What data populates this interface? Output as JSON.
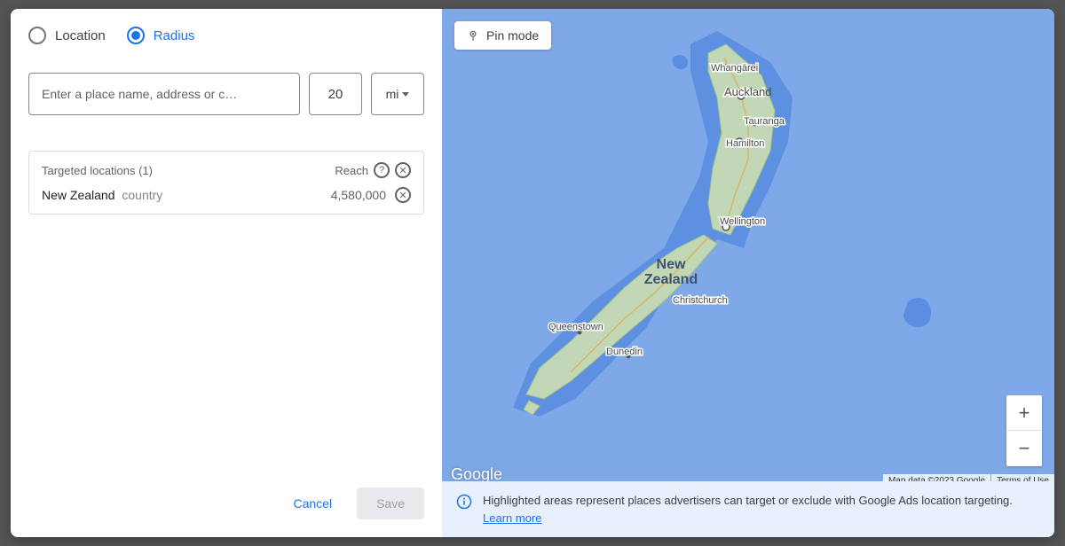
{
  "radio": {
    "location": "Location",
    "radius": "Radius"
  },
  "input": {
    "placeholder": "Enter a place name, address or c…",
    "radius_value": "20",
    "unit": "mi"
  },
  "targeted": {
    "header": "Targeted locations (1)",
    "reach_label": "Reach",
    "location_name": "New Zealand",
    "location_type": "country",
    "reach_value": "4,580,000"
  },
  "buttons": {
    "cancel": "Cancel",
    "save": "Save"
  },
  "map": {
    "pin_mode": "Pin mode",
    "attrib1": "Map data ©2023 Google",
    "attrib2": "Terms of Use",
    "google": "Google",
    "country": "New Zealand",
    "cities": {
      "auckland": "Auckland",
      "whangarei": "Whangārei",
      "tauranga": "Tauranga",
      "hamilton": "Hamilton",
      "wellington": "Wellington",
      "christchurch": "Christchurch",
      "dunedin": "Dunedin",
      "queenstown": "Queenstown"
    },
    "zoom_in": "+",
    "zoom_out": "−"
  },
  "info": {
    "text": "Highlighted areas represent places advertisers can target or exclude with Google Ads location targeting. ",
    "link": "Learn more"
  }
}
